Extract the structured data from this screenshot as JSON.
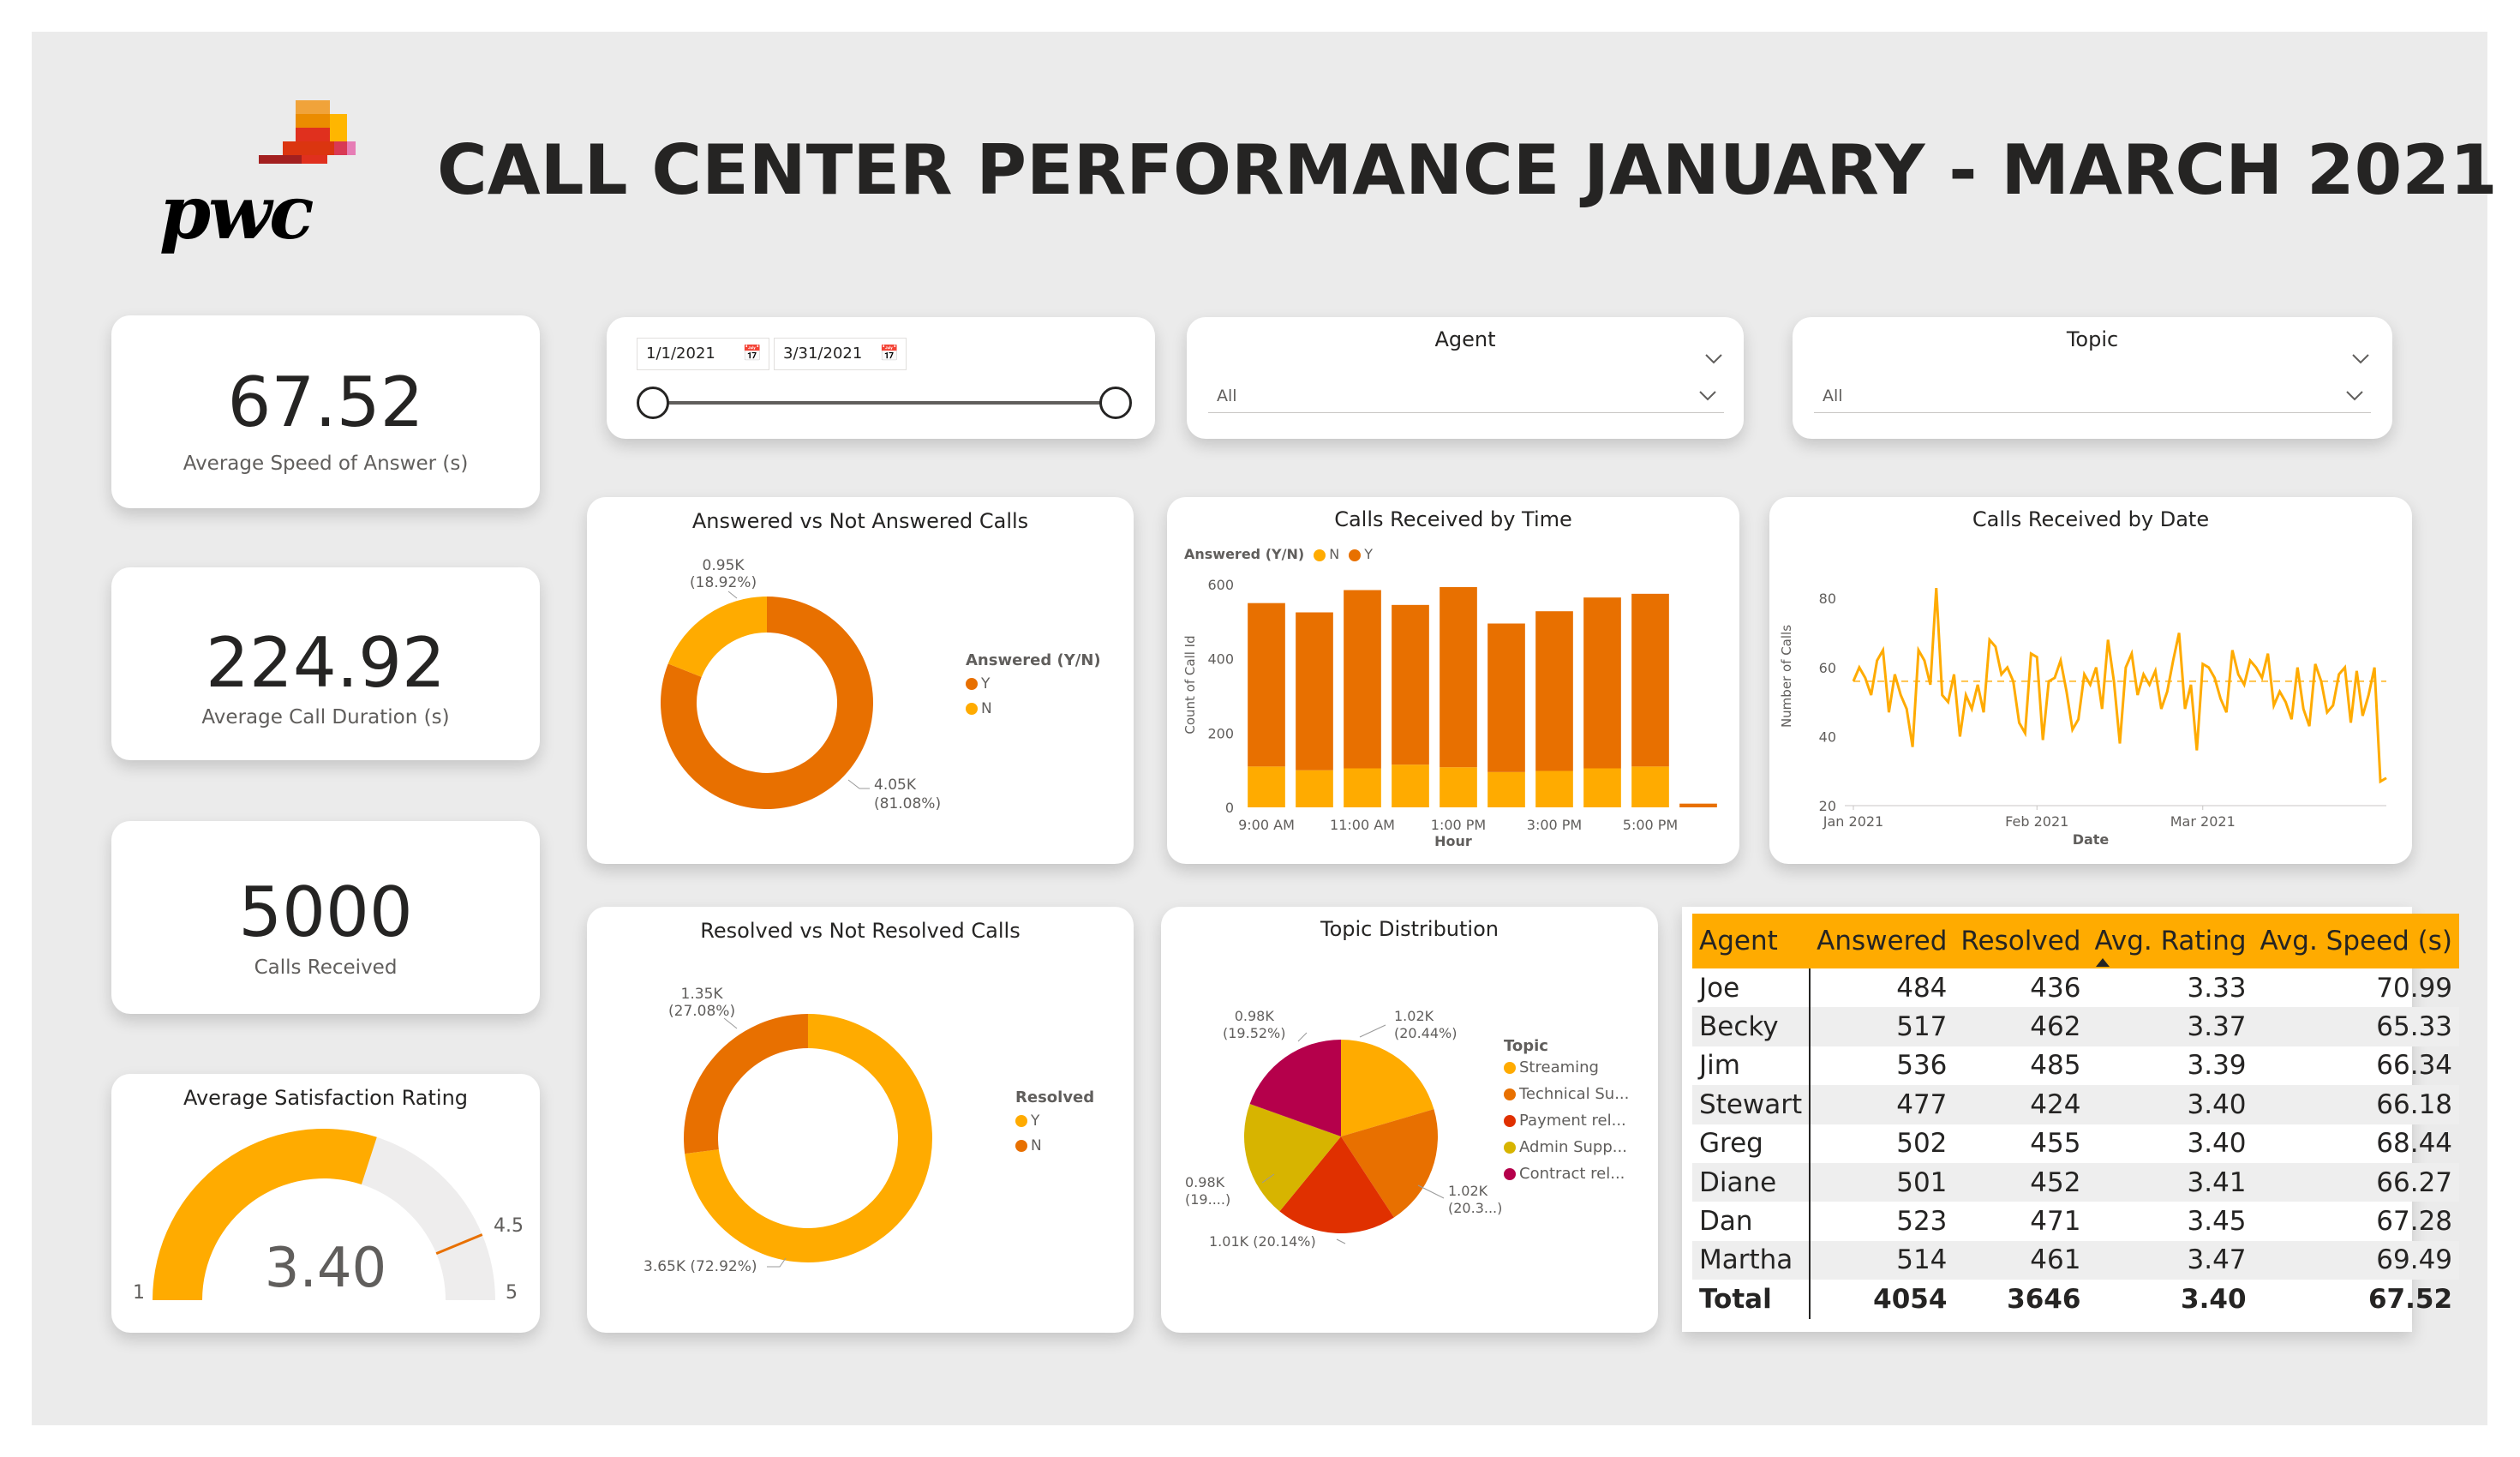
{
  "header": {
    "title": "CALL CENTER PERFORMANCE JANUARY - MARCH 2021",
    "logo_text": "pwc"
  },
  "colors": {
    "orange_dark": "#e87000",
    "orange_light": "#ffab00",
    "red": "#e03000",
    "olive": "#d7b400",
    "magenta": "#b5004b",
    "canvas": "#ebebeb"
  },
  "kpis": {
    "speed": {
      "value": "67.52",
      "label": "Average Speed of Answer (s)"
    },
    "duration": {
      "value": "224.92",
      "label": "Average Call Duration (s)"
    },
    "calls": {
      "value": "5000",
      "label": "Calls Received"
    }
  },
  "gauge": {
    "title": "Average Satisfaction Rating",
    "value_label": "3.40",
    "value": 3.4,
    "min_label": "1",
    "max_label": "5",
    "target_label": "4.5",
    "min": 1,
    "max": 5,
    "target": 4.5
  },
  "date_slicer": {
    "start": "1/1/2021",
    "end": "3/31/2021",
    "calendar_icon": "calendar-icon"
  },
  "agent_slicer": {
    "title": "Agent",
    "value": "All"
  },
  "topic_slicer": {
    "title": "Topic",
    "value": "All"
  },
  "answered_chart": {
    "title": "Answered vs Not Answered Calls",
    "legend_title": "Answered (Y/N)",
    "legend": [
      "Y",
      "N"
    ],
    "label_n": "0.95K",
    "label_n_pct": "(18.92%)",
    "label_y": "4.05K",
    "label_y_pct": "(81.08%)"
  },
  "resolved_chart": {
    "title": "Resolved vs Not Resolved Calls",
    "legend_title": "Resolved",
    "legend": [
      "Y",
      "N"
    ],
    "label_n": "1.35K",
    "label_n_pct": "(27.08%)",
    "label_y": "3.65K (72.92%)"
  },
  "time_chart": {
    "title": "Calls Received by Time",
    "legend_title": "Answered (Y/N)",
    "legend": [
      "N",
      "Y"
    ],
    "xlabel": "Hour",
    "ylabel": "Count of Call Id",
    "yticks": [
      "600",
      "400",
      "200",
      "0"
    ],
    "xticks": [
      "9:00 AM",
      "11:00 AM",
      "1:00 PM",
      "3:00 PM",
      "5:00 PM"
    ]
  },
  "date_chart": {
    "title": "Calls Received by Date",
    "xlabel": "Date",
    "ylabel": "Number of Calls",
    "yticks": [
      "80",
      "60",
      "40",
      "20"
    ],
    "xticks": [
      "Jan 2021",
      "Feb 2021",
      "Mar 2021"
    ]
  },
  "topic_chart": {
    "title": "Topic Distribution",
    "legend_title": "Topic",
    "legend": [
      "Streaming",
      "Technical Su...",
      "Payment rel...",
      "Admin Supp...",
      "Contract rel..."
    ],
    "labels": [
      {
        "value": "1.02K",
        "pct": "(20.44%)"
      },
      {
        "value": "1.02K",
        "pct": "(20.3...)"
      },
      {
        "value": "1.01K (20.14%)",
        "pct": ""
      },
      {
        "value": "0.98K",
        "pct": "(19....)"
      },
      {
        "value": "0.98K",
        "pct": "(19.52%)"
      }
    ]
  },
  "agent_table": {
    "headers": [
      "Agent",
      "Answered",
      "Resolved",
      "Avg. Rating",
      "Avg. Speed (s)"
    ],
    "sort_icon": "sort-ascending-icon",
    "rows": [
      [
        "Joe",
        "484",
        "436",
        "3.33",
        "70.99"
      ],
      [
        "Becky",
        "517",
        "462",
        "3.37",
        "65.33"
      ],
      [
        "Jim",
        "536",
        "485",
        "3.39",
        "66.34"
      ],
      [
        "Stewart",
        "477",
        "424",
        "3.40",
        "66.18"
      ],
      [
        "Greg",
        "502",
        "455",
        "3.40",
        "68.44"
      ],
      [
        "Diane",
        "501",
        "452",
        "3.41",
        "66.27"
      ],
      [
        "Dan",
        "523",
        "471",
        "3.45",
        "67.28"
      ],
      [
        "Martha",
        "514",
        "461",
        "3.47",
        "69.49"
      ]
    ],
    "total": [
      "Total",
      "4054",
      "3646",
      "3.40",
      "67.52"
    ]
  },
  "chart_data": [
    {
      "type": "pie",
      "title": "Answered vs Not Answered Calls",
      "categories": [
        "Y",
        "N"
      ],
      "values": [
        4050,
        950
      ],
      "percent": [
        81.08,
        18.92
      ],
      "legend": "right"
    },
    {
      "type": "pie",
      "title": "Resolved vs Not Resolved Calls",
      "categories": [
        "Y",
        "N"
      ],
      "values": [
        3650,
        1350
      ],
      "percent": [
        72.92,
        27.08
      ],
      "legend": "right"
    },
    {
      "type": "bar",
      "title": "Calls Received by Time",
      "xlabel": "Hour",
      "ylabel": "Count of Call Id",
      "categories": [
        "9:00 AM",
        "10:00 AM",
        "11:00 AM",
        "12:00 PM",
        "1:00 PM",
        "2:00 PM",
        "3:00 PM",
        "4:00 PM",
        "5:00 PM",
        "6:00 PM"
      ],
      "series": [
        {
          "name": "N",
          "values": [
            110,
            100,
            105,
            115,
            108,
            95,
            98,
            105,
            110,
            0
          ]
        },
        {
          "name": "Y",
          "values": [
            440,
            425,
            480,
            430,
            485,
            400,
            430,
            460,
            465,
            10
          ]
        }
      ],
      "ylim": [
        0,
        600
      ],
      "stacked": true,
      "legend": "top-left"
    },
    {
      "type": "line",
      "title": "Calls Received by Date",
      "xlabel": "Date",
      "ylabel": "Number of Calls",
      "x_start": "2021-01-01",
      "x_end": "2021-03-31",
      "series": [
        {
          "values": [
            56,
            60,
            57,
            52,
            62,
            65,
            47,
            58,
            52,
            48,
            37,
            65,
            62,
            55,
            83,
            52,
            50,
            58,
            40,
            52,
            48,
            55,
            47,
            68,
            66,
            58,
            60,
            56,
            44,
            41,
            64,
            63,
            39,
            56,
            57,
            62,
            53,
            42,
            45,
            58,
            55,
            60,
            48,
            68,
            56,
            38,
            60,
            64,
            52,
            58,
            55,
            59,
            48,
            53,
            62,
            70,
            48,
            55,
            36,
            61,
            60,
            57,
            51,
            47,
            65,
            58,
            55,
            62,
            60,
            57,
            64,
            49,
            53,
            50,
            45,
            60,
            48,
            43,
            61,
            56,
            47,
            49,
            58,
            60,
            44,
            59,
            46,
            52,
            60,
            27,
            28
          ]
        }
      ],
      "average_line": 56,
      "ylim": [
        20,
        85
      ],
      "grid": false
    },
    {
      "type": "pie",
      "title": "Topic Distribution",
      "categories": [
        "Streaming",
        "Technical Support",
        "Payment related",
        "Admin Support",
        "Contract related"
      ],
      "values": [
        1022,
        1015,
        1007,
        976,
        976
      ],
      "percent": [
        20.44,
        20.3,
        20.14,
        19.52,
        19.52
      ],
      "legend": "right"
    }
  ]
}
